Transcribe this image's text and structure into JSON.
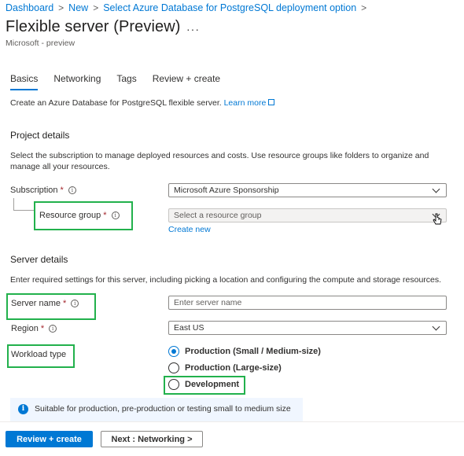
{
  "breadcrumb": {
    "items": [
      "Dashboard",
      "New",
      "Select Azure Database for PostgreSQL deployment option"
    ],
    "separator": ">"
  },
  "page": {
    "title": "Flexible server (Preview)",
    "more": "···",
    "subtitle": "Microsoft - preview"
  },
  "tabs": [
    {
      "label": "Basics",
      "active": true
    },
    {
      "label": "Networking",
      "active": false
    },
    {
      "label": "Tags",
      "active": false
    },
    {
      "label": "Review + create",
      "active": false
    }
  ],
  "intro": {
    "text": "Create an Azure Database for PostgreSQL flexible server.",
    "learn_more": "Learn more"
  },
  "project": {
    "heading": "Project details",
    "description": "Select the subscription to manage deployed resources and costs. Use resource groups like folders to organize and manage all your resources.",
    "subscription_label": "Subscription",
    "subscription_value": "Microsoft Azure Sponsorship",
    "resource_group_label": "Resource group",
    "resource_group_placeholder": "Select a resource group",
    "create_new": "Create new"
  },
  "server": {
    "heading": "Server details",
    "description": "Enter required settings for this server, including picking a location and configuring the compute and storage resources.",
    "server_name_label": "Server name",
    "server_name_placeholder": "Enter server name",
    "region_label": "Region",
    "region_value": "East US",
    "workload_label": "Workload type",
    "workload_options": [
      {
        "label": "Production (Small / Medium-size)",
        "selected": true
      },
      {
        "label": "Production (Large-size)",
        "selected": false
      },
      {
        "label": "Development",
        "selected": false
      }
    ]
  },
  "info": {
    "text": "Suitable for production, pre-production or testing small to medium size"
  },
  "footer": {
    "review_create": "Review + create",
    "next": "Next : Networking >"
  },
  "colors": {
    "accent": "#0078d4",
    "highlight_box": "#22b14c",
    "required": "#a4262c"
  },
  "icons": [
    "info-icon",
    "chevron-down-icon",
    "external-link-icon",
    "ellipsis-icon",
    "cursor-icon"
  ]
}
